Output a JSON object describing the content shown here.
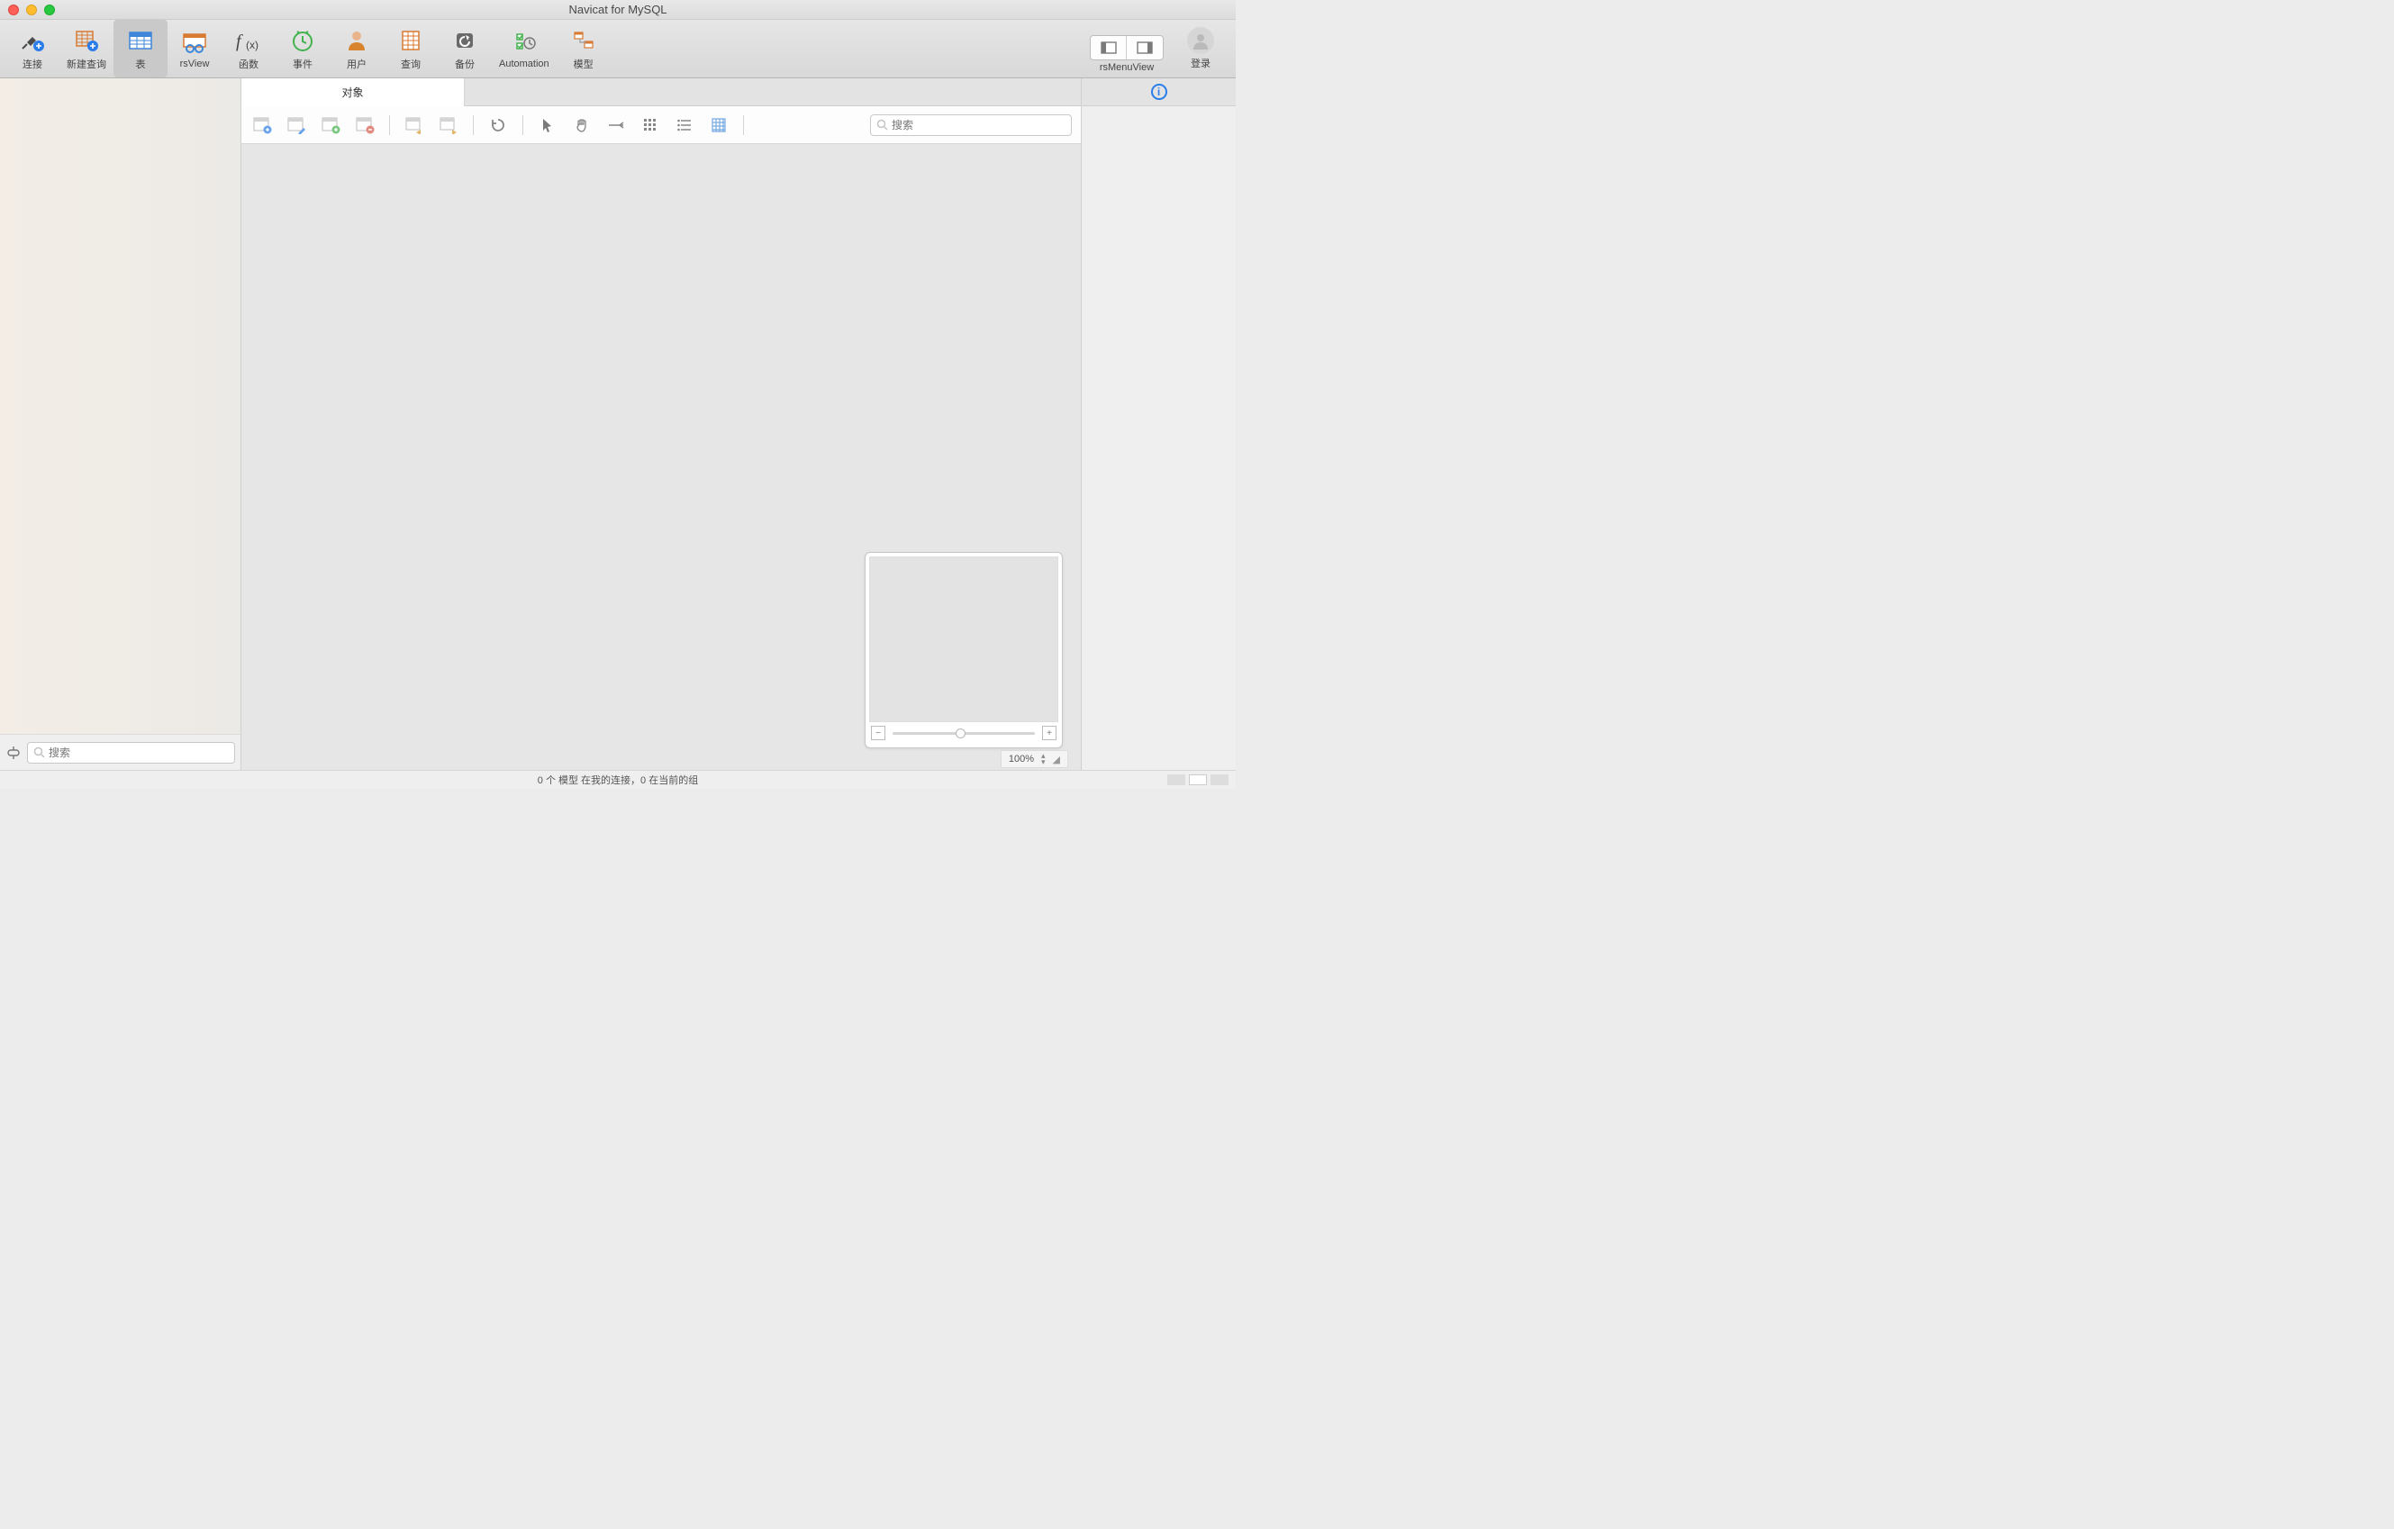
{
  "window": {
    "title": "Navicat for MySQL"
  },
  "toolbar": {
    "connect": "连接",
    "new_query": "新建查询",
    "table": "表",
    "rsview": "rsView",
    "function": "函数",
    "event": "事件",
    "user": "用户",
    "query": "查询",
    "backup": "备份",
    "automation": "Automation",
    "model": "模型",
    "menu_view": "rsMenuView",
    "login": "登录"
  },
  "tabs": {
    "objects": "对象"
  },
  "left_panel": {
    "search_placeholder": "搜索"
  },
  "obj_toolbar": {
    "search_placeholder": "搜索"
  },
  "zoom_indicator": "100%",
  "statusbar": {
    "text": "0 个 模型 在我的连接，0 在当前的组"
  }
}
